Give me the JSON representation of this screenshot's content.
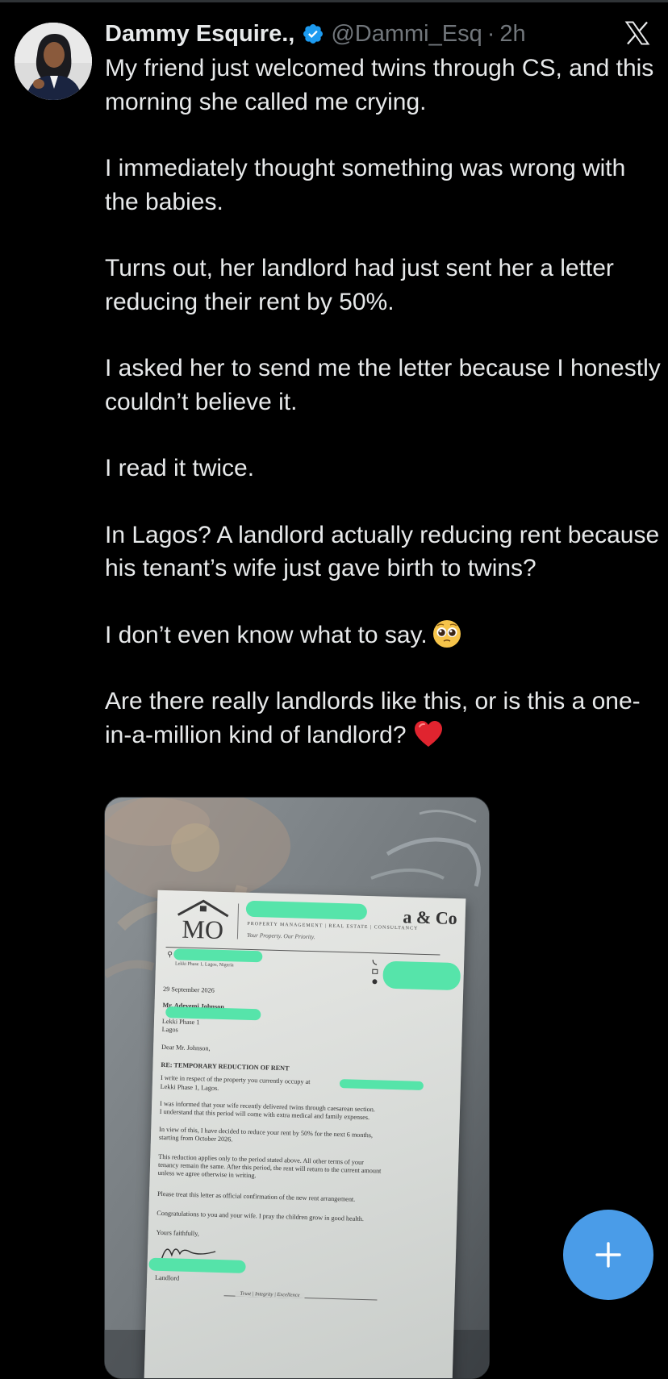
{
  "post": {
    "author_name": "Dammy Esquire.,",
    "handle": "@Dammi_Esq",
    "separator": "·",
    "time": "2h",
    "paragraphs": [
      "My friend just welcomed twins through CS, and this morning she called me crying.",
      "I immediately thought something was wrong with the babies.",
      "Turns out, her landlord had just sent her a letter reducing their rent by 50%.",
      "I asked her to send me the letter because I honestly couldn’t believe it.",
      "I read it twice.",
      "In Lagos? A landlord actually reducing rent because his tenant’s wife just gave birth to twins?",
      "I don’t even know what to say.",
      "Are there really landlords like this, or is this a one-in-a-million kind of landlord?"
    ],
    "emoji_after_p7": "pleading-face-emoji",
    "emoji_after_p8": "red-heart-emoji"
  },
  "letter": {
    "logo_text": "MO",
    "company_visible": "a & Co",
    "services": "PROPERTY MANAGEMENT  |  REAL ESTATE  |  CONSULTANCY",
    "tagline": "Your Property. Our Priority.",
    "address": "Lekki Phase 1, Lagos, Nigeria",
    "date": "29 September 2026",
    "recipient_name": "Mr. Adeyemi Johnson",
    "recipient_line2": "Lekki Phase 1",
    "recipient_line3": "Lagos",
    "salutation": "Dear Mr. Johnson,",
    "subject": "RE: TEMPORARY REDUCTION OF RENT",
    "p1a": "I write in respect of the property you currently occupy at",
    "p1b": "Lekki Phase 1, Lagos.",
    "p2a": "I was informed that your wife recently delivered twins through caesarean section.",
    "p2b": "I understand that this period will come with extra medical and family expenses.",
    "p3a": "In view of this, I have decided to reduce your rent by 50% for the next 6 months,",
    "p3b": "starting from October 2026.",
    "p4a": "This reduction applies only to the period stated above. All other terms of your",
    "p4b": "tenancy remain the same. After this period, the rent will return to the current amount",
    "p4c": "unless we agree otherwise in writing.",
    "p5": "Please treat this letter as official confirmation of the new rent arrangement.",
    "p6": "Congratulations to you and your wife. I pray the children grow in good health.",
    "closing": "Yours faithfully,",
    "signatory": "Landlord",
    "footer": "Trust  |  Integrity  |  Excellence"
  },
  "colors": {
    "background": "#000000",
    "text": "#e7e9ea",
    "muted": "#71767b",
    "verified": "#1d9bf0",
    "fab": "#4a9ce8",
    "redaction": "#4ee4a6"
  },
  "fab": {
    "icon": "plus-icon"
  }
}
